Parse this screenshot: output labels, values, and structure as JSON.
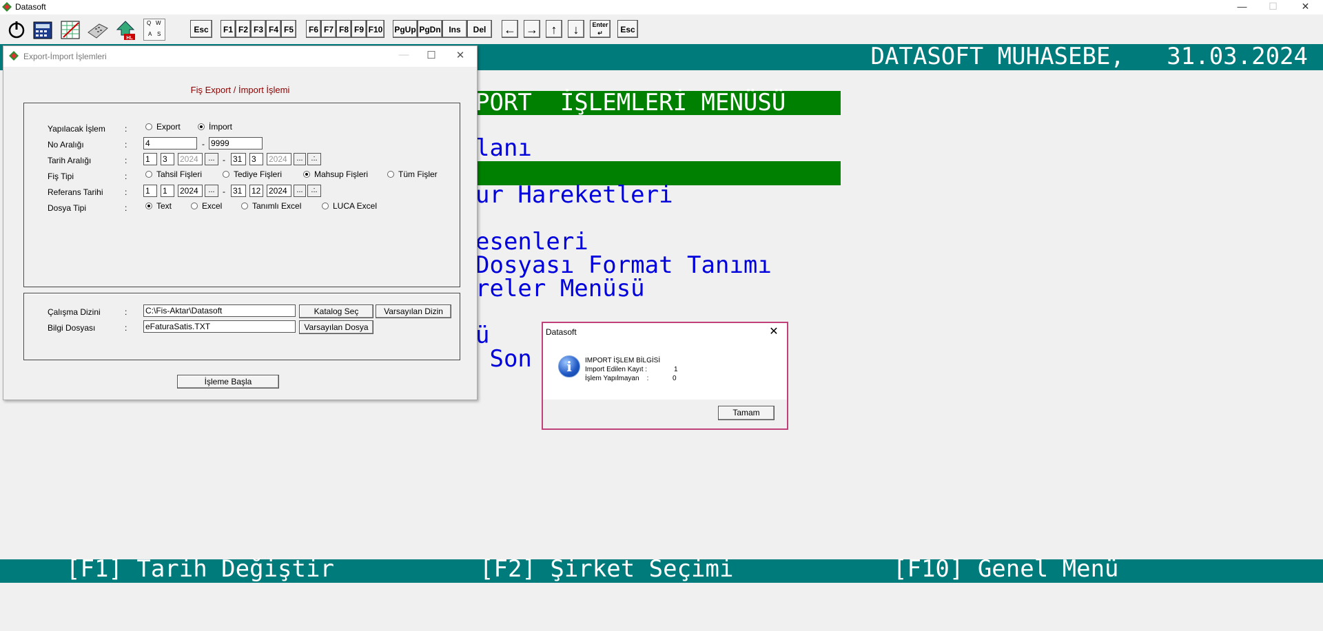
{
  "app": {
    "title": "Datasoft"
  },
  "window_controls": {
    "minimize": "—",
    "maximize": "☐",
    "close": "✕"
  },
  "toolbar": {
    "icons": [
      "power-icon",
      "calculator-icon",
      "spreadsheet-icon",
      "keyboard-icon",
      "hl-transfer-icon",
      "qwas-keyboard-icon"
    ],
    "qwas": [
      "Q",
      "W",
      "A",
      "S"
    ],
    "keys1": [
      "Esc"
    ],
    "keys2": [
      "F1",
      "F2",
      "F3",
      "F4",
      "F5"
    ],
    "keys3": [
      "F6",
      "F7",
      "F8",
      "F9",
      "F10"
    ],
    "keys4": [
      "PgUp",
      "PgDn",
      "Ins",
      "Del"
    ],
    "arrows": [
      "←",
      "→",
      "↑",
      "↓"
    ],
    "enter": "Enter",
    "esc2": "Esc"
  },
  "header": {
    "company_date": "DATASOFT MUHASEBE,   31.03.2024"
  },
  "console_menu": {
    "title": "PORT  İŞLEMLERİ MENÜSÜ",
    "items": [
      "lanı",
      "",
      "ur Hareketleri",
      "",
      "esenleri",
      "Dosyası Format Tanımı",
      "reler Menüsü",
      "",
      "ü",
      " Son"
    ]
  },
  "footer": {
    "f1": "[F1] Tarih Değiştir",
    "f2": "[F2] Şirket Seçimi",
    "f10": "[F10] Genel Menü"
  },
  "export_window": {
    "title": "Export-İmport İşlemleri",
    "heading": "Fiş Export / İmport İşlemi",
    "labels": {
      "islem": "Yapılacak İşlem",
      "no": "No Aralığı",
      "tarih": "Tarih Aralığı",
      "fis": "Fiş Tipi",
      "referans": "Referans Tarihi",
      "dosya": "Dosya Tipi",
      "dizin": "Çalışma Dizini",
      "bilgi": "Bilgi Dosyası"
    },
    "colon": ":",
    "islem_options": [
      {
        "label": "Export",
        "checked": false
      },
      {
        "label": "İmport",
        "checked": true
      }
    ],
    "no_from": "4",
    "no_to": "9999",
    "tarih_from": {
      "d": "1",
      "m": "3",
      "y": "2024"
    },
    "tarih_to": {
      "d": "31",
      "m": "3",
      "y": "2024"
    },
    "fis_options": [
      {
        "label": "Tahsil Fişleri",
        "checked": false
      },
      {
        "label": "Tediye Fişleri",
        "checked": false
      },
      {
        "label": "Mahsup Fişleri",
        "checked": true
      },
      {
        "label": "Tüm Fişler",
        "checked": false
      }
    ],
    "referans_from": {
      "d": "1",
      "m": "1",
      "y": "2024"
    },
    "referans_to": {
      "d": "31",
      "m": "12",
      "y": "2024"
    },
    "dosya_options": [
      {
        "label": "Text",
        "checked": true
      },
      {
        "label": "Excel",
        "checked": false
      },
      {
        "label": "Tanımlı Excel",
        "checked": false
      },
      {
        "label": "LUCA Excel",
        "checked": false
      }
    ],
    "dash": "-",
    "ellipsis": "...",
    "calendar": ".:.",
    "dizin_value": "C:\\Fis-Aktar\\Datasoft",
    "bilgi_value": "eFaturaSatis.TXT",
    "katalog_button": "Katalog Seç",
    "varsayilan_dizin_button": "Varsayılan Dizin",
    "varsayilan_dosya_button": "Varsayılan Dosya",
    "start_button": "İşleme Başla"
  },
  "message_box": {
    "title": "Datasoft",
    "close": "✕",
    "icon": "info-icon",
    "icon_glyph": "i",
    "heading": "IMPORT İŞLEM BİLGİSİ",
    "line1_label": "Import Edilen Kayıt :",
    "line1_value": "1",
    "line2_label": "İşlem Yapılmayan    :",
    "line2_value": "0",
    "ok_button": "Tamam"
  },
  "colors": {
    "teal": "#007b7b",
    "menu_green": "#008000",
    "menu_blue": "#0000dd",
    "heading_red": "#8b0000",
    "dialog_border": "#c0407a"
  }
}
